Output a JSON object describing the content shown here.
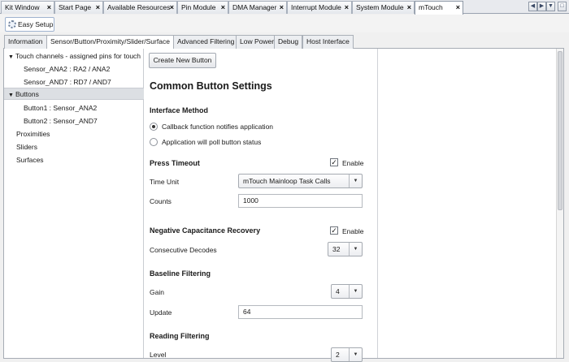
{
  "doc_tabs": [
    "Kit Window",
    "Start Page",
    "Available Resources",
    "Pin Module",
    "DMA Manager",
    "Interrupt Module",
    "System Module",
    "mTouch"
  ],
  "toolbar": {
    "easy_setup_label": "Easy Setup"
  },
  "inner_tabs": [
    "Information",
    "Sensor/Button/Proximity/Slider/Surface",
    "Advanced Filtering",
    "Low Power",
    "Debug",
    "Host Interface"
  ],
  "tree": {
    "touch_channels": "Touch channels - assigned pins for touch",
    "sensor1": "Sensor_ANA2 : RA2 / ANA2",
    "sensor2": "Sensor_AND7 : RD7 / AND7",
    "buttons": "Buttons",
    "button1": "Button1 : Sensor_ANA2",
    "button2": "Button2 : Sensor_AND7",
    "proximities": "Proximities",
    "sliders": "Sliders",
    "surfaces": "Surfaces"
  },
  "form": {
    "create_button": "Create New Button",
    "heading": "Common Button Settings",
    "interface_method": "Interface Method",
    "radio_callback": "Callback function notifies application",
    "radio_poll": "Application will poll button status",
    "press_timeout": "Press Timeout",
    "enable": "Enable",
    "time_unit_label": "Time Unit",
    "time_unit_value": "mTouch Mainloop Task Calls",
    "counts_label": "Counts",
    "counts_value": "1000",
    "ncr": "Negative Capacitance Recovery",
    "consecutive_label": "Consecutive Decodes",
    "consecutive_value": "32",
    "baseline": "Baseline Filtering",
    "gain_label": "Gain",
    "gain_value": "4",
    "update_label": "Update",
    "update_value": "64",
    "reading": "Reading Filtering",
    "level_label": "Level",
    "level_value": "2"
  }
}
